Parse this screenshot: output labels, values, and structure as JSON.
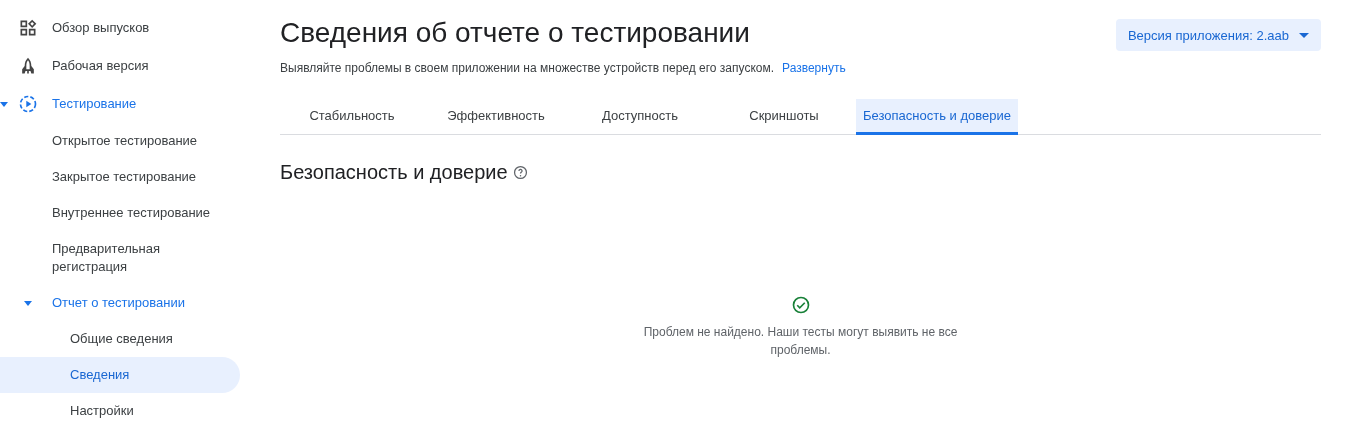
{
  "sidebar": {
    "items": [
      {
        "label": "Обзор выпусков",
        "kind": "grid",
        "selected": false
      },
      {
        "label": "Рабочая версия",
        "kind": "rocket",
        "selected": false
      },
      {
        "label": "Тестирование",
        "kind": "play",
        "selected": false,
        "expanded": true,
        "children": [
          {
            "label": "Открытое тестирование",
            "selected": false
          },
          {
            "label": "Закрытое тестирование",
            "selected": false
          },
          {
            "label": "Внутреннее тестирование",
            "selected": false
          },
          {
            "label": "Предварительная регистрация",
            "selected": false
          },
          {
            "label": "Отчет о тестировании",
            "selected": false,
            "expanded": true,
            "children": [
              {
                "label": "Общие сведения",
                "selected": false
              },
              {
                "label": "Сведения",
                "selected": true
              },
              {
                "label": "Настройки",
                "selected": false
              }
            ]
          }
        ]
      }
    ]
  },
  "header": {
    "title": "Сведения об отчете о тестировании",
    "subtitle": "Выявляйте проблемы в своем приложении на множестве устройств перед его запуском.",
    "link": "Развернуть",
    "version_button": "Версия приложения: 2.aab"
  },
  "tabs": [
    {
      "label": "Стабильность",
      "selected": false
    },
    {
      "label": "Эффективность",
      "selected": false
    },
    {
      "label": "Доступность",
      "selected": false
    },
    {
      "label": "Скриншоты",
      "selected": false
    },
    {
      "label": "Безопасность и доверие",
      "selected": true
    }
  ],
  "section": {
    "title": "Безопасность и доверие",
    "empty_message": "Проблем не найдено. Наши тесты могут выявить не все проблемы."
  }
}
